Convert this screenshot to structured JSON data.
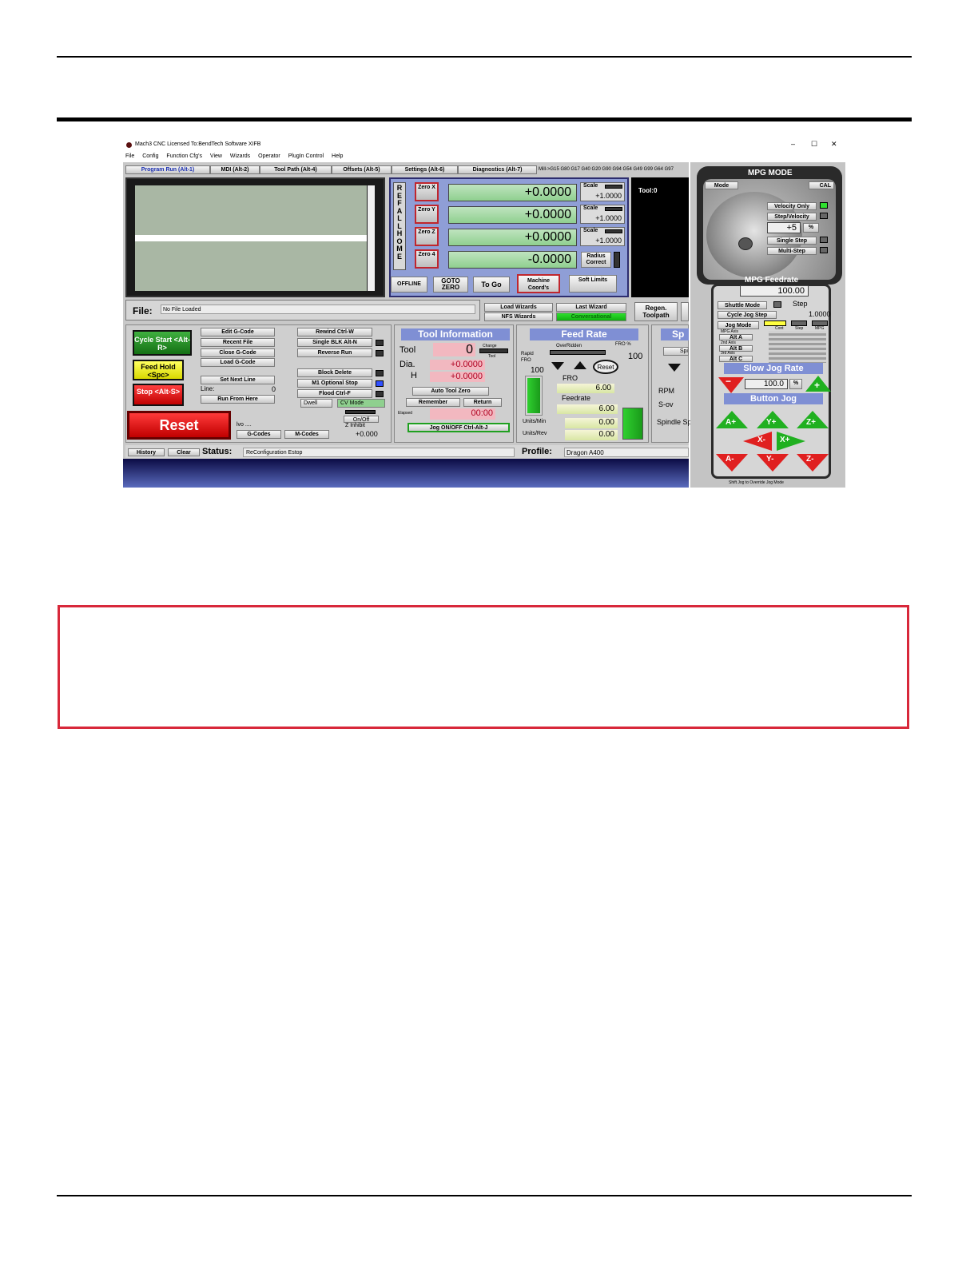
{
  "app": {
    "title": "Mach3 CNC  Licensed To:BendTech Software XIFB",
    "window_controls": [
      "–",
      "☐",
      "✕"
    ],
    "menu": [
      "File",
      "Config",
      "Function Cfg's",
      "View",
      "Wizards",
      "Operator",
      "PlugIn Control",
      "Help"
    ]
  },
  "tabs": [
    "Program Run (Alt-1)",
    "MDI (Alt-2)",
    "Tool Path (Alt-4)",
    "Offsets (Alt-5)",
    "Settings (Alt-6)",
    "Diagnostics (Alt-7)"
  ],
  "gcodes_line": "Mill->G15  G80 G17 G40 G20 G90 G94 G54 G49 G99 G64 G97",
  "ref_all_home": "REF ALL HOME",
  "axes": [
    {
      "zero_label": "Zero X",
      "value": "+0.0000",
      "scale_label": "Scale",
      "scale": "+1.0000"
    },
    {
      "zero_label": "Zero Y",
      "value": "+0.0000",
      "scale_label": "Scale",
      "scale": "+1.0000"
    },
    {
      "zero_label": "Zero Z",
      "value": "+0.0000",
      "scale_label": "Scale",
      "scale": "+1.0000"
    },
    {
      "zero_label": "Zero 4",
      "value": "-0.0000",
      "radius_label": "Radius Correct"
    }
  ],
  "dro_buttons": [
    "OFFLINE",
    "GOTO ZERO",
    "To Go",
    "Machine Coord's",
    "Soft Limits"
  ],
  "tool_display": "Tool:0",
  "file": {
    "label": "File:",
    "value": "No File Loaded"
  },
  "wizards": [
    "Load Wizards",
    "Last Wizard",
    "NFS Wizards",
    "Conversational"
  ],
  "regen": "Regen. Toolpath",
  "cycle": {
    "start": "Cycle Start <Alt-R>",
    "feedhold": "Feed Hold <Spc>",
    "stop": "Stop <Alt-S>",
    "reset": "Reset"
  },
  "gcode_buttons": [
    "Edit G-Code",
    "Recent File",
    "Close G-Code",
    "Load G-Code",
    "Set Next Line",
    "Run From Here"
  ],
  "line": {
    "label": "Line:",
    "value": "0"
  },
  "right_buttons": [
    "Rewind Ctrl-W",
    "Single BLK Alt-N",
    "Reverse Run",
    "Block Delete",
    "M1 Optional Stop",
    "Flood Ctrl-F",
    "Dwell",
    "CV Mode"
  ],
  "onoff": "On/Off",
  "zinhibit": {
    "label": "Z Inhibit",
    "value": "+0.000"
  },
  "code_buttons": [
    "G-Codes",
    "M-Codes"
  ],
  "lvo": "lvo ....",
  "tool_info": {
    "title": "Tool Information",
    "tool_label": "Tool",
    "tool_value": "0",
    "change_label": "Change",
    "tool_small": "Tool",
    "dia_label": "Dia.",
    "dia_value": "+0.0000",
    "h_label": "H",
    "h_value": "+0.0000",
    "auto_zero": "Auto Tool Zero",
    "remember": "Remember",
    "return": "Return",
    "elapsed_label": "Elapsed",
    "elapsed_value": "00:00",
    "jog_toggle": "Jog ON/OFF Ctrl-Alt-J"
  },
  "feed_rate": {
    "title": "Feed Rate",
    "overridden": "OverRidden",
    "fro_pct_label": "FRO %",
    "fro_pct": "100",
    "rapid_label": "Rapid FRO",
    "rapid_value": "100",
    "reset": "Reset",
    "fro_label": "FRO",
    "fro_value": "6.00",
    "feedrate_label": "Feedrate",
    "feedrate_value": "6.00",
    "units_min_label": "Units/Min",
    "units_min": "0.00",
    "units_rev_label": "Units/Rev",
    "units_rev": "0.00"
  },
  "spindle": {
    "title": "Sp",
    "button": "Spi",
    "rpm": "RPM",
    "sov": "S-ov",
    "speed": "Spindle Sp"
  },
  "bottom": {
    "history": "History",
    "clear": "Clear",
    "status_label": "Status:",
    "status": "ReConfiguration Estop",
    "profile_label": "Profile:",
    "profile": "Dragon A400"
  },
  "mpg": {
    "title": "MPG MODE",
    "mode": "Mode",
    "cal": "CAL",
    "velocity_only": "Velocity Only",
    "step_velocity": "Step/Velocity",
    "step_value": "+5",
    "percent": "%",
    "single_step": "Single Step",
    "multi_step": "Multi-Step",
    "feedrate_title": "MPG Feedrate",
    "feedrate_value": "100.00",
    "shuttle": "Shuttle Mode",
    "step": "Step",
    "cycle_jog": "Cycle Jog Step",
    "cycle_jog_value": "1.0000",
    "jog_mode": "Jog Mode",
    "col_headers": [
      "Cont",
      "Step",
      "MPG"
    ],
    "mpg_axis": "MPG Axis",
    "alt_a": "Alt A",
    "alt_b": "Alt B",
    "alt_c": "Alt C",
    "axis_2nd": "2nd Axis",
    "axis_3rd": "3rd Axis",
    "slow_jog": "Slow Jog Rate",
    "slow_jog_value": "100.0",
    "button_jog": "Button Jog",
    "jog_buttons": [
      "A+",
      "Y+",
      "Z+",
      "X-",
      "X+",
      "A-",
      "Y-",
      "Z-"
    ],
    "shift_note": "Shift Jog to Override Jog Mode",
    "minus": "−",
    "plus": "+"
  },
  "colors": {
    "accent_red": "#d8283a",
    "dro_green": "#8fd08f",
    "panel_blue": "#2d2d6e",
    "header_blue": "#7f8fd4"
  }
}
